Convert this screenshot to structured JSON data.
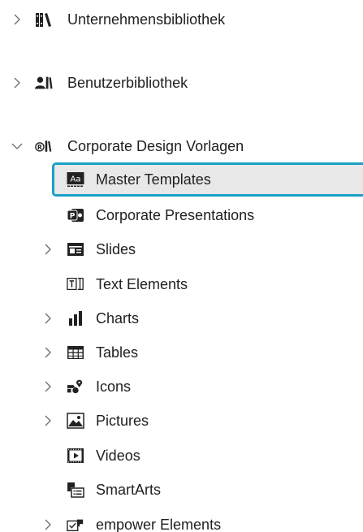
{
  "tree": {
    "libraries": [
      {
        "label": "Unternehmensbibliothek",
        "icon": "books-icon",
        "expanded": false
      },
      {
        "label": "Benutzerbibliothek",
        "icon": "user-library-icon",
        "expanded": false
      },
      {
        "label": "Corporate Design Vorlagen",
        "icon": "registered-library-icon",
        "expanded": true
      }
    ],
    "children": [
      {
        "label": "Master Templates",
        "icon": "master-templates-icon",
        "has_chevron": false,
        "selected": true
      },
      {
        "label": "Corporate Presentations",
        "icon": "presentation-icon",
        "has_chevron": false
      },
      {
        "label": "Slides",
        "icon": "slides-icon",
        "has_chevron": true
      },
      {
        "label": "Text Elements",
        "icon": "text-elements-icon",
        "has_chevron": false
      },
      {
        "label": "Charts",
        "icon": "charts-icon",
        "has_chevron": true
      },
      {
        "label": "Tables",
        "icon": "tables-icon",
        "has_chevron": true
      },
      {
        "label": "Icons",
        "icon": "icons-icon",
        "has_chevron": true
      },
      {
        "label": "Pictures",
        "icon": "pictures-icon",
        "has_chevron": true
      },
      {
        "label": "Videos",
        "icon": "videos-icon",
        "has_chevron": false
      },
      {
        "label": "SmartArts",
        "icon": "smartarts-icon",
        "has_chevron": false
      },
      {
        "label": "empower Elements",
        "icon": "empower-elements-icon",
        "has_chevron": true
      }
    ]
  },
  "colors": {
    "selection_border": "#1aa0c6",
    "selection_fill": "#e8e8e8",
    "text": "#1f1f1f",
    "chevron": "#6b6b6b"
  }
}
